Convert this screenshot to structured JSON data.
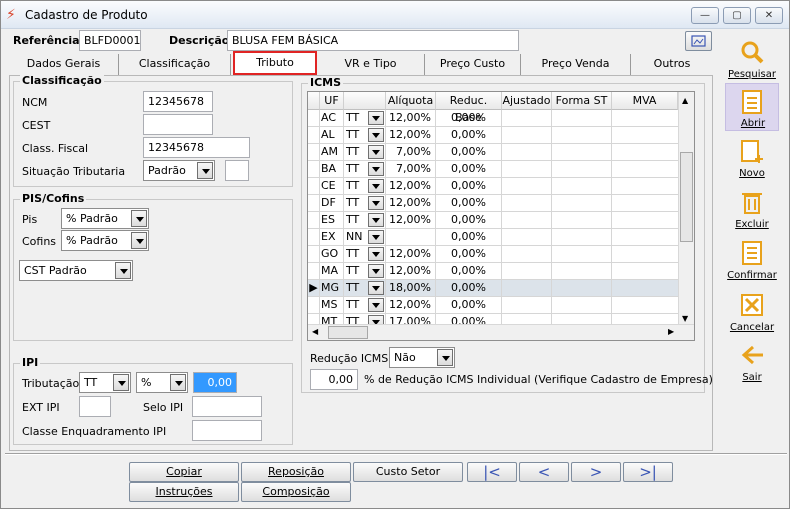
{
  "window": {
    "title": "Cadastro de Produto",
    "minimize": "—",
    "maximize": "▢",
    "close": "✕"
  },
  "header": {
    "referencia_label": "Referência",
    "referencia_value": "BLFD0001",
    "descricao_label": "Descrição",
    "descricao_value": "BLUSA FEM BÁSICA"
  },
  "tabs": [
    "Dados Gerais",
    "Classificação",
    "Tributo",
    "VR e Tipo",
    "Preço Custo",
    "Preço Venda",
    "Outros"
  ],
  "classificacao": {
    "title": "Classificação",
    "ncm_label": "NCM",
    "ncm_value": "12345678",
    "cest_label": "CEST",
    "cest_value": "",
    "class_fiscal_label": "Class. Fiscal",
    "class_fiscal_value": "12345678",
    "sit_trib_label": "Situação Tributaria",
    "sit_trib_value": "Padrão"
  },
  "pis_cofins": {
    "title": "PIS/Cofins",
    "pis_label": "Pis",
    "pis_value": "% Padrão",
    "cofins_label": "Cofins",
    "cofins_value": "% Padrão",
    "cst_value": "CST Padrão"
  },
  "ipi": {
    "title": "IPI",
    "tributacao_label": "Tributação",
    "tributacao_value": "TT",
    "tipo_value": "%",
    "valor": "0,00",
    "ext_ipi_label": "EXT IPI",
    "selo_ipi_label": "Selo IPI",
    "classe_label": "Classe Enquadramento IPI"
  },
  "icms": {
    "title": "ICMS",
    "columns": [
      "UF",
      "",
      "Alíquota",
      "Reduc. Base",
      "Ajustado",
      "Forma ST",
      "MVA"
    ],
    "rows": [
      {
        "uf": "AC",
        "tipo": "TT",
        "aliquota": "12,00%",
        "reduc": "0,00%"
      },
      {
        "uf": "AL",
        "tipo": "TT",
        "aliquota": "12,00%",
        "reduc": "0,00%"
      },
      {
        "uf": "AM",
        "tipo": "TT",
        "aliquota": "7,00%",
        "reduc": "0,00%"
      },
      {
        "uf": "BA",
        "tipo": "TT",
        "aliquota": "7,00%",
        "reduc": "0,00%"
      },
      {
        "uf": "CE",
        "tipo": "TT",
        "aliquota": "12,00%",
        "reduc": "0,00%"
      },
      {
        "uf": "DF",
        "tipo": "TT",
        "aliquota": "12,00%",
        "reduc": "0,00%"
      },
      {
        "uf": "ES",
        "tipo": "TT",
        "aliquota": "12,00%",
        "reduc": "0,00%"
      },
      {
        "uf": "EX",
        "tipo": "NN",
        "aliquota": "",
        "reduc": "0,00%"
      },
      {
        "uf": "GO",
        "tipo": "TT",
        "aliquota": "12,00%",
        "reduc": "0,00%"
      },
      {
        "uf": "MA",
        "tipo": "TT",
        "aliquota": "12,00%",
        "reduc": "0,00%"
      },
      {
        "uf": "MG",
        "tipo": "TT",
        "aliquota": "18,00%",
        "reduc": "0,00%"
      },
      {
        "uf": "MS",
        "tipo": "TT",
        "aliquota": "12,00%",
        "reduc": "0,00%"
      },
      {
        "uf": "MT",
        "tipo": "TT",
        "aliquota": "17,00%",
        "reduc": "0,00%"
      }
    ],
    "reducao_label": "Redução ICMS",
    "reducao_value": "Não",
    "perc_value": "0,00",
    "perc_label": "% de Redução ICMS Individual (Verifique Cadastro de Empresa)"
  },
  "sidebar": [
    {
      "label": "Pesquisar",
      "icon": "search-icon",
      "color": "#e8a21c"
    },
    {
      "label": "Abrir",
      "icon": "open-icon",
      "color": "#e8a21c"
    },
    {
      "label": "Novo",
      "icon": "new-icon",
      "color": "#e8a21c"
    },
    {
      "label": "Excluir",
      "icon": "delete-icon",
      "color": "#e8a21c"
    },
    {
      "label": "Confirmar",
      "icon": "confirm-icon",
      "color": "#e8a21c"
    },
    {
      "label": "Cancelar",
      "icon": "cancel-icon",
      "color": "#e8a21c"
    },
    {
      "label": "Sair",
      "icon": "exit-icon",
      "color": "#e8a21c"
    }
  ],
  "bottom": {
    "copiar": "Copiar",
    "reposicao": "Reposição",
    "custo_setor": "Custo Setor",
    "instrucoes": "Instruções",
    "composicao": "Composição"
  }
}
